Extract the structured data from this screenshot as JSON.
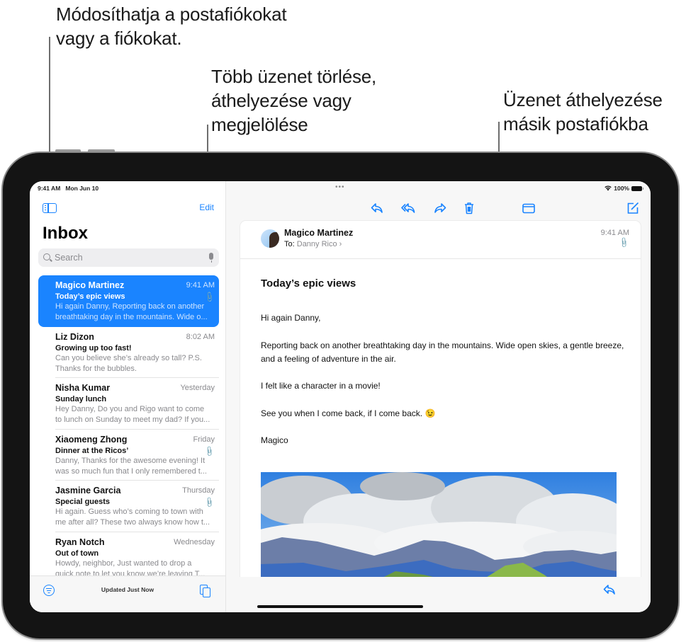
{
  "callouts": {
    "accounts": [
      "Módosíthatja a postafiókokat",
      "vagy a fiókokat."
    ],
    "edit": [
      "Több üzenet törlése,",
      "áthelyezése vagy",
      "megjelölése"
    ],
    "move": [
      "Üzenet áthelyezése",
      "másik postafiókba"
    ]
  },
  "status_bar": {
    "time": "9:41 AM",
    "date": "Mon Jun 10",
    "battery": "100%"
  },
  "sidebar": {
    "edit_label": "Edit",
    "title": "Inbox",
    "search_placeholder": "Search",
    "footer_status": "Updated Just Now",
    "messages": [
      {
        "from": "Magico Martinez",
        "time": "9:41 AM",
        "subject": "Today’s epic views",
        "preview": [
          "Hi again Danny, Reporting back on another",
          "breathtaking day in the mountains. Wide o..."
        ],
        "attachment": true,
        "selected": true
      },
      {
        "from": "Liz Dizon",
        "time": "8:02 AM",
        "subject": "Growing up too fast!",
        "preview": [
          "Can you believe she’s already so tall? P.S.",
          "Thanks for the bubbles."
        ],
        "attachment": false,
        "selected": false
      },
      {
        "from": "Nisha Kumar",
        "time": "Yesterday",
        "subject": "Sunday lunch",
        "preview": [
          "Hey Danny, Do you and Rigo want to come",
          "to lunch on Sunday to meet my dad? If you..."
        ],
        "attachment": false,
        "selected": false
      },
      {
        "from": "Xiaomeng Zhong",
        "time": "Friday",
        "subject": "Dinner at the Ricos’",
        "preview": [
          "Danny, Thanks for the awesome evening! It",
          "was so much fun that I only remembered t..."
        ],
        "attachment": true,
        "selected": false
      },
      {
        "from": "Jasmine Garcia",
        "time": "Thursday",
        "subject": "Special guests",
        "preview": [
          "Hi again. Guess who’s coming to town with",
          "me after all? These two always know how t..."
        ],
        "attachment": true,
        "selected": false
      },
      {
        "from": "Ryan Notch",
        "time": "Wednesday",
        "subject": "Out of town",
        "preview": [
          "Howdy, neighbor, Just wanted to drop a",
          "quick note to let you know we’re leaving T..."
        ],
        "attachment": false,
        "selected": false
      }
    ]
  },
  "message": {
    "sender": "Magico Martinez",
    "to_label": "To:",
    "recipient": "Danny Rico",
    "time": "9:41 AM",
    "subject": "Today’s epic views",
    "body": [
      "Hi again Danny,",
      "Reporting back on another breathtaking day in the mountains. Wide open skies, a gentle breeze, and a feeling of adventure in the air.",
      "I felt like a character in a movie!",
      "See you when I come back, if I come back. 😉",
      "Magico"
    ]
  },
  "toolbar": {
    "icons": [
      "reply-icon",
      "reply-all-icon",
      "forward-icon",
      "trash-icon",
      "folder-icon",
      "compose-icon",
      "more-icon"
    ]
  },
  "colors": {
    "accent": "#1a84ff",
    "selected_row": "#1a84ff",
    "secondary_text": "#8a8a8e"
  }
}
